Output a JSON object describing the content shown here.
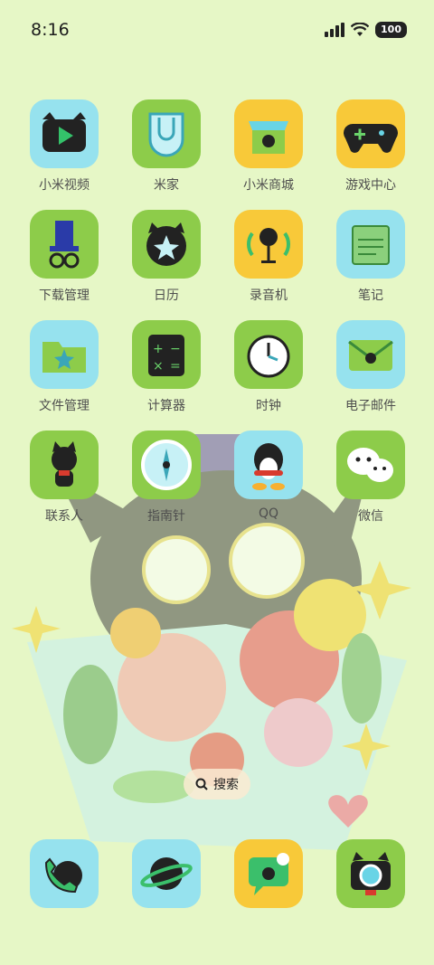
{
  "status_bar": {
    "time": "8:16",
    "battery": "100",
    "icons": [
      "signal-icon",
      "wifi-icon",
      "battery-icon"
    ]
  },
  "apps": [
    {
      "label": "小米视频",
      "color": "cyan",
      "icon": "video-play-icon"
    },
    {
      "label": "米家",
      "color": "green",
      "icon": "mijia-icon"
    },
    {
      "label": "小米商城",
      "color": "yellow",
      "icon": "store-icon"
    },
    {
      "label": "游戏中心",
      "color": "yellow",
      "icon": "gamepad-icon"
    },
    {
      "label": "下载管理",
      "color": "green",
      "icon": "download-icon"
    },
    {
      "label": "日历",
      "color": "green",
      "icon": "calendar-icon"
    },
    {
      "label": "录音机",
      "color": "yellow",
      "icon": "microphone-icon"
    },
    {
      "label": "笔记",
      "color": "cyan",
      "icon": "notes-icon"
    },
    {
      "label": "文件管理",
      "color": "cyan",
      "icon": "folder-icon"
    },
    {
      "label": "计算器",
      "color": "green",
      "icon": "calculator-icon"
    },
    {
      "label": "时钟",
      "color": "green",
      "icon": "clock-icon"
    },
    {
      "label": "电子邮件",
      "color": "cyan",
      "icon": "mail-icon"
    },
    {
      "label": "联系人",
      "color": "green",
      "icon": "contacts-icon"
    },
    {
      "label": "指南针",
      "color": "green",
      "icon": "compass-icon"
    },
    {
      "label": "QQ",
      "color": "cyan",
      "icon": "qq-penguin-icon"
    },
    {
      "label": "微信",
      "color": "green",
      "icon": "wechat-icon"
    }
  ],
  "search": {
    "label": "搜索"
  },
  "dock": [
    {
      "color": "cyan",
      "icon": "phone-icon"
    },
    {
      "color": "cyan",
      "icon": "browser-planet-icon"
    },
    {
      "color": "yellow",
      "icon": "messages-icon"
    },
    {
      "color": "green",
      "icon": "camera-icon"
    }
  ],
  "colors": {
    "background": "#e6f7c6",
    "cyan": "#96e2ee",
    "green": "#8dcc4a",
    "yellow": "#f8c939"
  }
}
